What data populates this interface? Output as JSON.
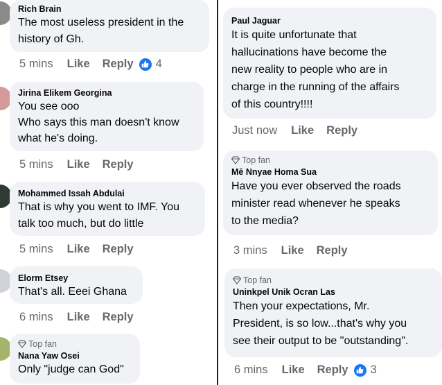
{
  "left_comments": [
    {
      "name": "Rich Brain",
      "top_fan": false,
      "text": "The most useless president in the\nhistory of Gh.",
      "time": "5 mins",
      "like": "Like",
      "reply": "Reply",
      "reactions": "4"
    },
    {
      "name": "Jirina Elikem Georgina",
      "top_fan": false,
      "text": "You see ooo\nWho says this man doesn't know\nwhat he's doing.",
      "time": "5 mins",
      "like": "Like",
      "reply": "Reply",
      "reactions": ""
    },
    {
      "name": "Mohammed Issah Abdulai",
      "top_fan": false,
      "text": "That is why you went to IMF. You\ntalk too much, but do little",
      "time": "5 mins",
      "like": "Like",
      "reply": "Reply",
      "reactions": ""
    },
    {
      "name": "Elorm Etsey",
      "top_fan": false,
      "text": "That's all. Eeei Ghana",
      "time": "6 mins",
      "like": "Like",
      "reply": "Reply",
      "reactions": ""
    },
    {
      "name": "Nana Yaw Osei",
      "top_fan": true,
      "top_fan_label": "Top fan",
      "text": "Only \"judge can God\"",
      "time": "",
      "like": "",
      "reply": "",
      "reactions": ""
    }
  ],
  "right_comments": [
    {
      "name": "Paul Jaguar",
      "top_fan": false,
      "text": "It is quite unfortunate that\nhallucinations have become the\nnew reality to people who are in\ncharge in the running of the affairs\nof this country!!!!",
      "time": "Just now",
      "like": "Like",
      "reply": "Reply",
      "reactions": ""
    },
    {
      "name": "Mē Nnyae Homa Sua",
      "top_fan": true,
      "top_fan_label": "Top fan",
      "text": "Have you ever observed the roads\nminister read whenever he speaks\nto the media?",
      "time": "3 mins",
      "like": "Like",
      "reply": "Reply",
      "reactions": ""
    },
    {
      "name": "Uninkpel Unik Ocran Las",
      "top_fan": true,
      "top_fan_label": "Top fan",
      "text": "Then your expectations, Mr.\nPresident, is so low...that's why you\nsee their output to be \"outstanding\".",
      "time": "6 mins",
      "like": "Like",
      "reply": "Reply",
      "reactions": "3"
    }
  ],
  "colors": {
    "bubble": "#f0f2f5",
    "meta": "#65676b",
    "like_blue": "#1877f2"
  },
  "icons": {
    "top_fan": "diamond-icon",
    "reaction": "thumbs-up-icon"
  }
}
